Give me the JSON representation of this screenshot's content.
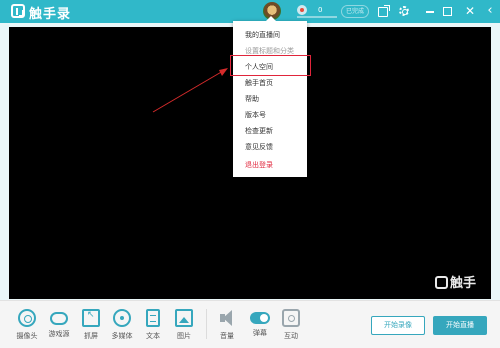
{
  "app": {
    "title": "触手录"
  },
  "header": {
    "score": "0",
    "status_pill": "已完成",
    "icons": [
      "share-icon",
      "gear-icon",
      "minimize-icon",
      "maximize-icon",
      "close-icon",
      "back-icon"
    ]
  },
  "menu": {
    "items": [
      {
        "label": "我的直播间",
        "style": "normal"
      },
      {
        "label": "设置标题和分类",
        "style": "muted"
      },
      {
        "label": "个人空间",
        "style": "normal",
        "highlighted": true
      },
      {
        "label": "触手首页",
        "style": "normal"
      },
      {
        "label": "帮助",
        "style": "normal"
      },
      {
        "label": "版本号",
        "style": "normal"
      },
      {
        "label": "检查更新",
        "style": "normal"
      },
      {
        "label": "意见反馈",
        "style": "normal"
      },
      {
        "label": "退出登录",
        "style": "danger"
      }
    ]
  },
  "preview": {
    "watermark": "触手"
  },
  "toolbar": {
    "tools": [
      {
        "label": "摄像头",
        "icon": "camera-icon"
      },
      {
        "label": "游戏源",
        "icon": "gamepad-icon"
      },
      {
        "label": "抓屏",
        "icon": "screen-capture-icon"
      },
      {
        "label": "多媒体",
        "icon": "media-icon"
      },
      {
        "label": "文本",
        "icon": "text-icon"
      },
      {
        "label": "图片",
        "icon": "image-icon"
      },
      {
        "label": "音量",
        "icon": "volume-icon"
      },
      {
        "label": "弹幕",
        "icon": "toggle-icon"
      },
      {
        "label": "互动",
        "icon": "interact-icon"
      }
    ],
    "record_label": "开始录像",
    "live_label": "开始直播"
  },
  "colors": {
    "brand": "#30b8c9",
    "accent": "#36a7bd",
    "danger": "#e0253b"
  }
}
